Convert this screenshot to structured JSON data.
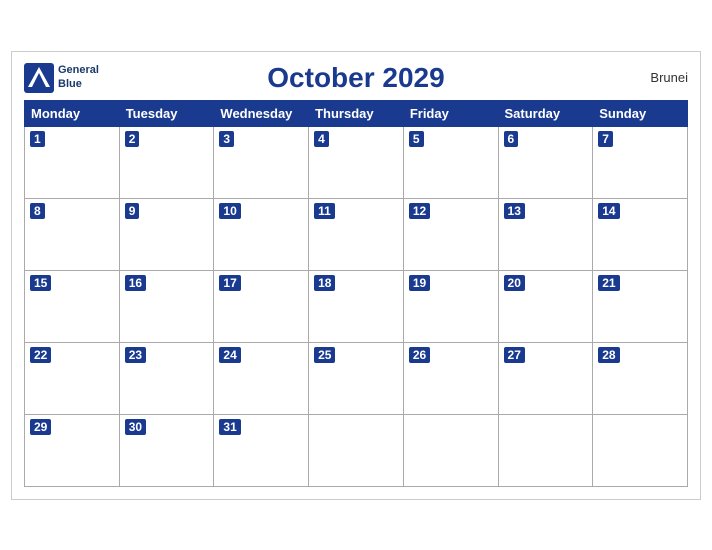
{
  "header": {
    "title": "October 2029",
    "country": "Brunei",
    "logo_line1": "General",
    "logo_line2": "Blue"
  },
  "weekdays": [
    "Monday",
    "Tuesday",
    "Wednesday",
    "Thursday",
    "Friday",
    "Saturday",
    "Sunday"
  ],
  "weeks": [
    [
      1,
      2,
      3,
      4,
      5,
      6,
      7
    ],
    [
      8,
      9,
      10,
      11,
      12,
      13,
      14
    ],
    [
      15,
      16,
      17,
      18,
      19,
      20,
      21
    ],
    [
      22,
      23,
      24,
      25,
      26,
      27,
      28
    ],
    [
      29,
      30,
      31,
      null,
      null,
      null,
      null
    ]
  ]
}
